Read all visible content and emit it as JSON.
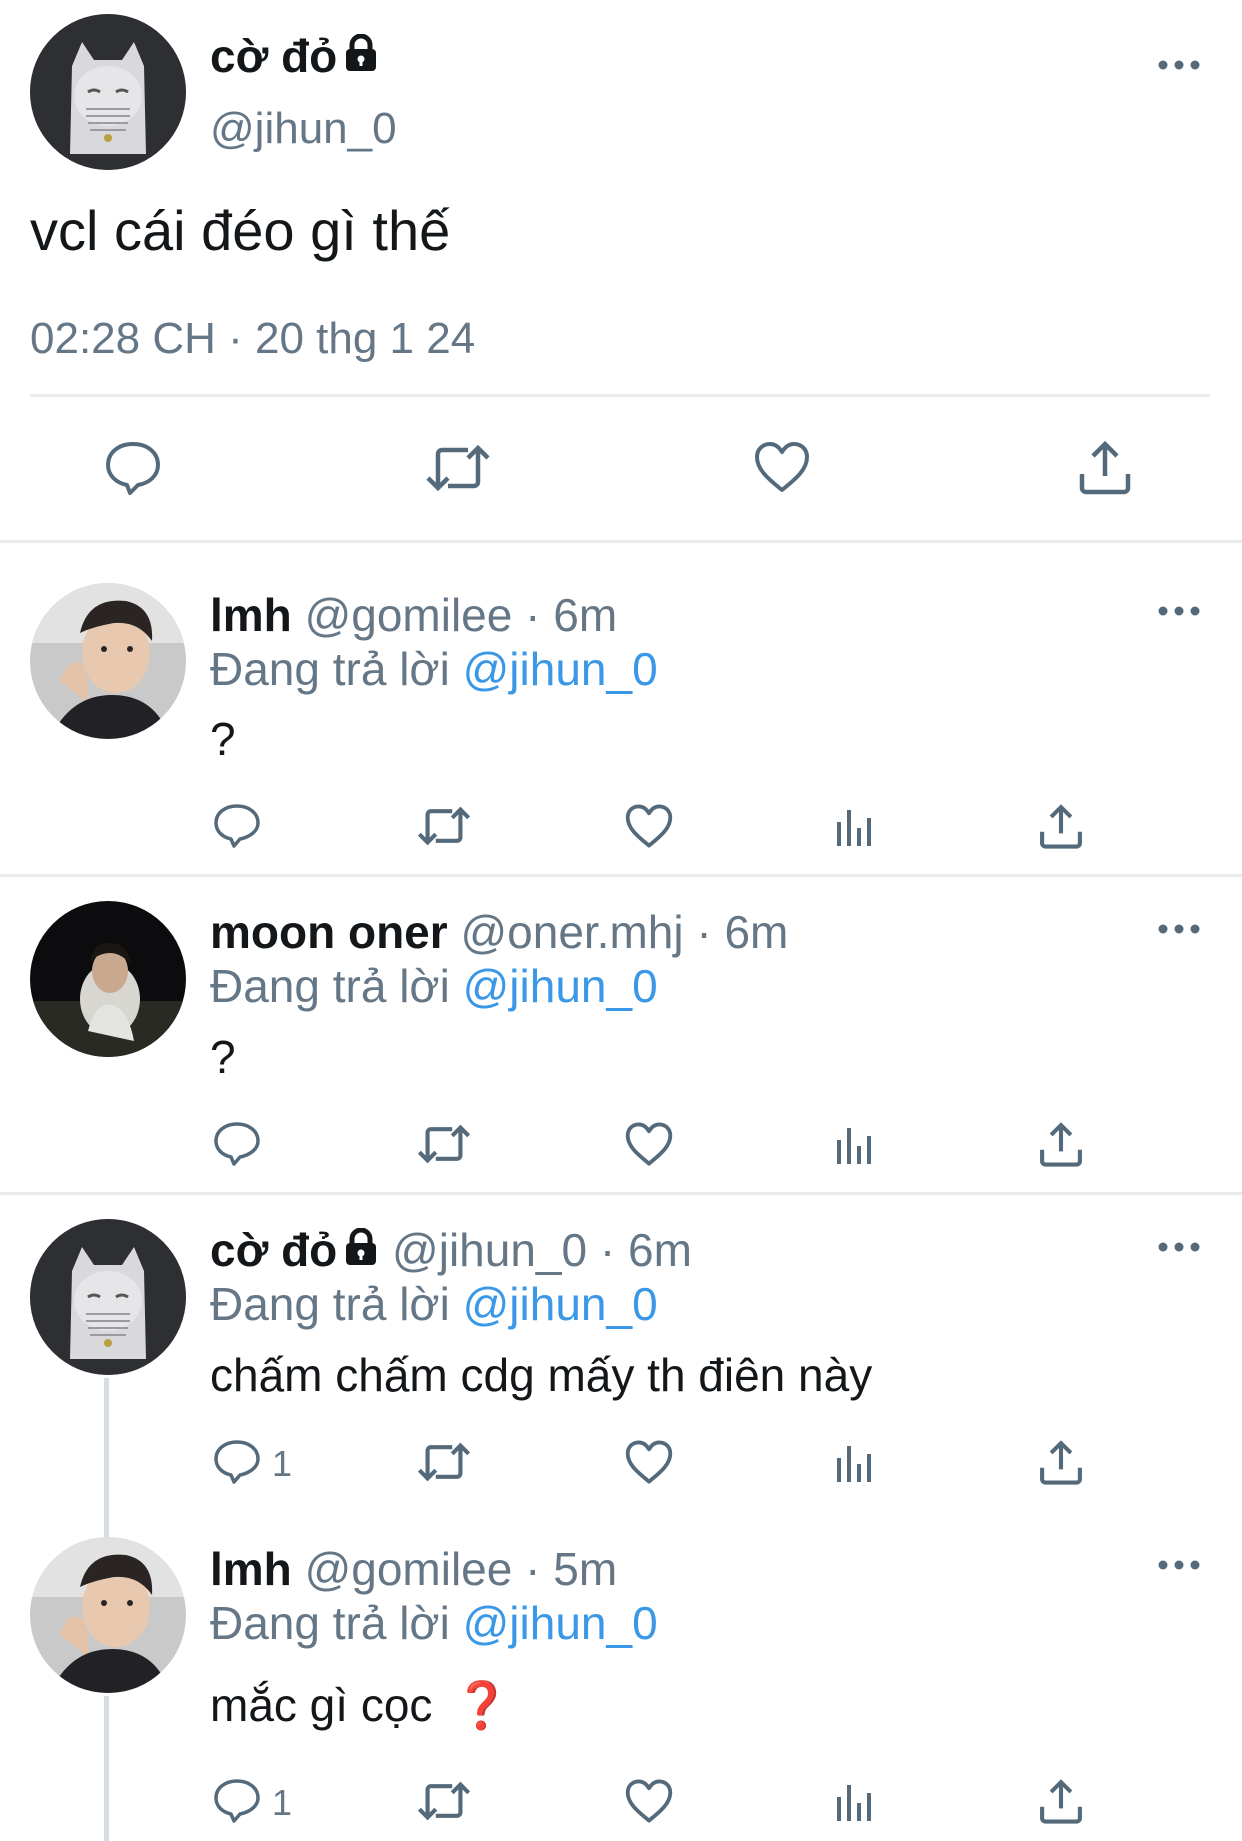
{
  "main_tweet": {
    "display_name": "cờ đỏ",
    "handle": "@jihun_0",
    "text": "vcl cái đéo gì thế",
    "timestamp": "02:28 CH · 20 thg 1 24",
    "icons": [
      "reply-icon",
      "retweet-icon",
      "like-icon",
      "share-icon"
    ]
  },
  "replies": [
    {
      "display_name": "lmh",
      "handle": "@gomilee",
      "time": "· 6m",
      "replying_prefix": "Đang trả lời",
      "replying_to": "@jihun_0",
      "text": "?",
      "reply_count": ""
    },
    {
      "display_name": "moon oner",
      "handle": "@oner.mhj",
      "time": "· 6m",
      "replying_prefix": "Đang trả lời",
      "replying_to": "@jihun_0",
      "text": "?",
      "reply_count": ""
    },
    {
      "display_name": "cờ đỏ",
      "handle": "@jihun_0",
      "time": "· 6m",
      "replying_prefix": "Đang trả lời",
      "replying_to": "@jihun_0",
      "text": "chấm chấm cdg mấy th điên này",
      "reply_count": "1"
    },
    {
      "display_name": "lmh",
      "handle": "@gomilee",
      "time": "· 5m",
      "replying_prefix": "Đang trả lời",
      "replying_to": "@jihun_0",
      "text": "mắc gì cọc",
      "emoji": "❓",
      "reply_count": "1"
    }
  ],
  "colors": {
    "link": "#3a98e6",
    "secondary_text": "#657786",
    "icon": "#546a7b",
    "divider": "#e8ecef",
    "thread_line": "#d6dde3"
  }
}
